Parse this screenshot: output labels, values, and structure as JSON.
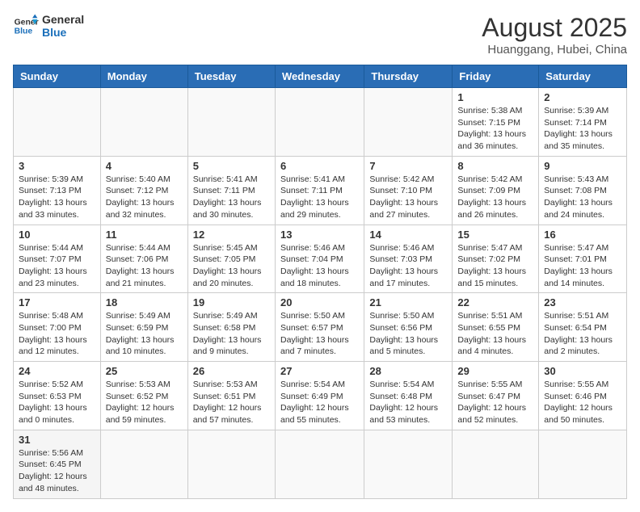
{
  "logo": {
    "text_general": "General",
    "text_blue": "Blue"
  },
  "title": "August 2025",
  "location": "Huanggang, Hubei, China",
  "weekdays": [
    "Sunday",
    "Monday",
    "Tuesday",
    "Wednesday",
    "Thursday",
    "Friday",
    "Saturday"
  ],
  "weeks": [
    [
      {
        "day": "",
        "info": ""
      },
      {
        "day": "",
        "info": ""
      },
      {
        "day": "",
        "info": ""
      },
      {
        "day": "",
        "info": ""
      },
      {
        "day": "",
        "info": ""
      },
      {
        "day": "1",
        "info": "Sunrise: 5:38 AM\nSunset: 7:15 PM\nDaylight: 13 hours and 36 minutes."
      },
      {
        "day": "2",
        "info": "Sunrise: 5:39 AM\nSunset: 7:14 PM\nDaylight: 13 hours and 35 minutes."
      }
    ],
    [
      {
        "day": "3",
        "info": "Sunrise: 5:39 AM\nSunset: 7:13 PM\nDaylight: 13 hours and 33 minutes."
      },
      {
        "day": "4",
        "info": "Sunrise: 5:40 AM\nSunset: 7:12 PM\nDaylight: 13 hours and 32 minutes."
      },
      {
        "day": "5",
        "info": "Sunrise: 5:41 AM\nSunset: 7:11 PM\nDaylight: 13 hours and 30 minutes."
      },
      {
        "day": "6",
        "info": "Sunrise: 5:41 AM\nSunset: 7:11 PM\nDaylight: 13 hours and 29 minutes."
      },
      {
        "day": "7",
        "info": "Sunrise: 5:42 AM\nSunset: 7:10 PM\nDaylight: 13 hours and 27 minutes."
      },
      {
        "day": "8",
        "info": "Sunrise: 5:42 AM\nSunset: 7:09 PM\nDaylight: 13 hours and 26 minutes."
      },
      {
        "day": "9",
        "info": "Sunrise: 5:43 AM\nSunset: 7:08 PM\nDaylight: 13 hours and 24 minutes."
      }
    ],
    [
      {
        "day": "10",
        "info": "Sunrise: 5:44 AM\nSunset: 7:07 PM\nDaylight: 13 hours and 23 minutes."
      },
      {
        "day": "11",
        "info": "Sunrise: 5:44 AM\nSunset: 7:06 PM\nDaylight: 13 hours and 21 minutes."
      },
      {
        "day": "12",
        "info": "Sunrise: 5:45 AM\nSunset: 7:05 PM\nDaylight: 13 hours and 20 minutes."
      },
      {
        "day": "13",
        "info": "Sunrise: 5:46 AM\nSunset: 7:04 PM\nDaylight: 13 hours and 18 minutes."
      },
      {
        "day": "14",
        "info": "Sunrise: 5:46 AM\nSunset: 7:03 PM\nDaylight: 13 hours and 17 minutes."
      },
      {
        "day": "15",
        "info": "Sunrise: 5:47 AM\nSunset: 7:02 PM\nDaylight: 13 hours and 15 minutes."
      },
      {
        "day": "16",
        "info": "Sunrise: 5:47 AM\nSunset: 7:01 PM\nDaylight: 13 hours and 14 minutes."
      }
    ],
    [
      {
        "day": "17",
        "info": "Sunrise: 5:48 AM\nSunset: 7:00 PM\nDaylight: 13 hours and 12 minutes."
      },
      {
        "day": "18",
        "info": "Sunrise: 5:49 AM\nSunset: 6:59 PM\nDaylight: 13 hours and 10 minutes."
      },
      {
        "day": "19",
        "info": "Sunrise: 5:49 AM\nSunset: 6:58 PM\nDaylight: 13 hours and 9 minutes."
      },
      {
        "day": "20",
        "info": "Sunrise: 5:50 AM\nSunset: 6:57 PM\nDaylight: 13 hours and 7 minutes."
      },
      {
        "day": "21",
        "info": "Sunrise: 5:50 AM\nSunset: 6:56 PM\nDaylight: 13 hours and 5 minutes."
      },
      {
        "day": "22",
        "info": "Sunrise: 5:51 AM\nSunset: 6:55 PM\nDaylight: 13 hours and 4 minutes."
      },
      {
        "day": "23",
        "info": "Sunrise: 5:51 AM\nSunset: 6:54 PM\nDaylight: 13 hours and 2 minutes."
      }
    ],
    [
      {
        "day": "24",
        "info": "Sunrise: 5:52 AM\nSunset: 6:53 PM\nDaylight: 13 hours and 0 minutes."
      },
      {
        "day": "25",
        "info": "Sunrise: 5:53 AM\nSunset: 6:52 PM\nDaylight: 12 hours and 59 minutes."
      },
      {
        "day": "26",
        "info": "Sunrise: 5:53 AM\nSunset: 6:51 PM\nDaylight: 12 hours and 57 minutes."
      },
      {
        "day": "27",
        "info": "Sunrise: 5:54 AM\nSunset: 6:49 PM\nDaylight: 12 hours and 55 minutes."
      },
      {
        "day": "28",
        "info": "Sunrise: 5:54 AM\nSunset: 6:48 PM\nDaylight: 12 hours and 53 minutes."
      },
      {
        "day": "29",
        "info": "Sunrise: 5:55 AM\nSunset: 6:47 PM\nDaylight: 12 hours and 52 minutes."
      },
      {
        "day": "30",
        "info": "Sunrise: 5:55 AM\nSunset: 6:46 PM\nDaylight: 12 hours and 50 minutes."
      }
    ],
    [
      {
        "day": "31",
        "info": "Sunrise: 5:56 AM\nSunset: 6:45 PM\nDaylight: 12 hours and 48 minutes."
      },
      {
        "day": "",
        "info": ""
      },
      {
        "day": "",
        "info": ""
      },
      {
        "day": "",
        "info": ""
      },
      {
        "day": "",
        "info": ""
      },
      {
        "day": "",
        "info": ""
      },
      {
        "day": "",
        "info": ""
      }
    ]
  ]
}
